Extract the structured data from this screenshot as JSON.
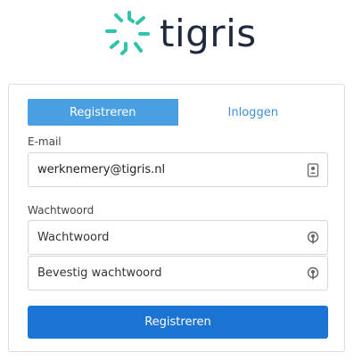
{
  "brand": {
    "name": "tigris",
    "mark_color": "#2ec4a9",
    "text_color": "#1f2a3f"
  },
  "tabs": [
    {
      "label": "Registreren",
      "active": true
    },
    {
      "label": "Inloggen",
      "active": false
    }
  ],
  "email": {
    "label": "E-mail",
    "value": "werknemery@tigris.nl",
    "icon": "contact-card-icon"
  },
  "password": {
    "label": "Wachtwoord",
    "placeholder": "Wachtwoord",
    "icon": "password-key-icon"
  },
  "confirm_password": {
    "placeholder": "Bevestig wachtwoord",
    "icon": "password-key-icon"
  },
  "submit": {
    "label": "Registreren"
  },
  "colors": {
    "tab_active": "#4a9fe3",
    "tab_inactive_text": "#3d8fd9",
    "button": "#1b73d3"
  }
}
